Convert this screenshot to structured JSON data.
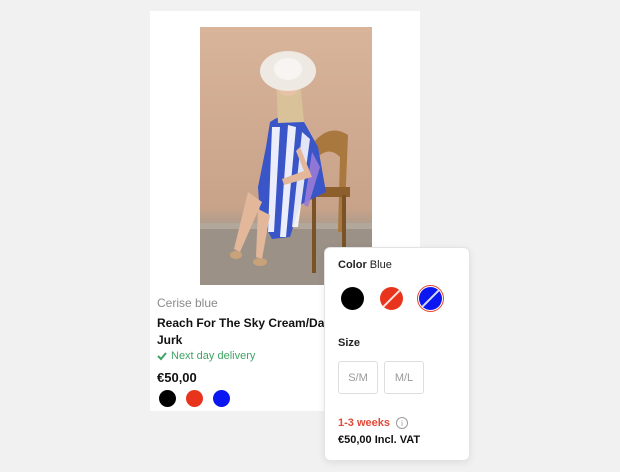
{
  "product": {
    "brand": "Cerise blue",
    "title_line1": "Reach For The Sky Cream/Da",
    "title_line2": "Jurk",
    "delivery": "Next day delivery",
    "price": "€50,00",
    "swatches": [
      {
        "name": "black",
        "color": "#000000"
      },
      {
        "name": "red",
        "color": "#e8341c"
      },
      {
        "name": "blue",
        "color": "#0b17f0"
      }
    ]
  },
  "popover": {
    "color_label": "Color",
    "color_value": "Blue",
    "swatches": [
      {
        "name": "black",
        "color": "#000000",
        "unavailable": false,
        "selected": false
      },
      {
        "name": "red",
        "color": "#e8341c",
        "unavailable": true,
        "selected": false
      },
      {
        "name": "blue",
        "color": "#0b17f0",
        "unavailable": true,
        "selected": true
      }
    ],
    "size_label": "Size",
    "sizes": [
      "S/M",
      "M/L"
    ],
    "stock": "1-3 weeks",
    "info_icon": "info-icon",
    "price": "€50,00 Incl. VAT"
  },
  "colors": {
    "delivery_green": "#3fa364",
    "stock_red": "#e04a3a"
  }
}
